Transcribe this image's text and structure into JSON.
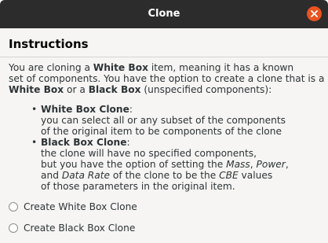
{
  "window": {
    "title": "Clone"
  },
  "dialog": {
    "heading": "Instructions",
    "intro": {
      "line1_a": "You are cloning a ",
      "line1_b": "White Box",
      "line1_c": " item, meaning it has a known",
      "line2": "set of components. You have the option to create a clone that is a",
      "line3_a": "White Box",
      "line3_b": " or a ",
      "line3_c": "Black Box",
      "line3_d": " (unspecified components):"
    },
    "bullets": [
      {
        "title": "White Box Clone",
        "title_suffix": ":",
        "lines": [
          "you can select all or any subset of the components",
          "of the original item to be components of the clone"
        ]
      },
      {
        "title": "Black Box Clone",
        "title_suffix": ":",
        "line1": "the clone will have no specified components,",
        "line2_a": "but you have the option of setting the ",
        "line2_b": "Mass",
        "line2_c": ", ",
        "line2_d": "Power",
        "line2_e": ",",
        "line3_a": "and ",
        "line3_b": "Data Rate",
        "line3_c": " of the clone to be the ",
        "line3_d": "CBE",
        "line3_e": " values",
        "line4": "of those parameters in the original item."
      }
    ],
    "options": [
      {
        "label": "Create White Box Clone",
        "selected": false
      },
      {
        "label": "Create Black Box Clone",
        "selected": false
      }
    ]
  },
  "icons": {
    "close": "close-icon",
    "bullet": "bullet-icon"
  },
  "colors": {
    "titlebar": "#2c2c2c",
    "close_button": "#e95420",
    "background": "#f6f5f4"
  }
}
